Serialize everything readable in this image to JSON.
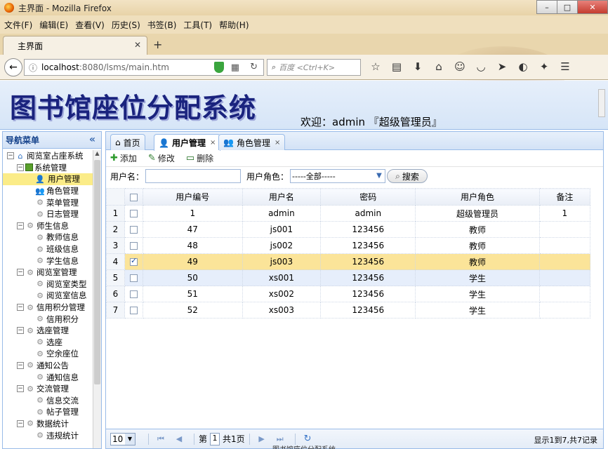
{
  "browser": {
    "window_title": "主界面 - Mozilla Firefox",
    "window_buttons": [
      "–",
      "□",
      "✕"
    ],
    "menu": [
      "文件(F)",
      "编辑(E)",
      "查看(V)",
      "历史(S)",
      "书签(B)",
      "工具(T)",
      "帮助(H)"
    ],
    "tab_title": "主界面",
    "url_host": "localhost",
    "url_path": ":8080/lsms/main.htm",
    "search_placeholder": "百度 <Ctrl+K>"
  },
  "app": {
    "system_title": "图书馆座位分配系统",
    "welcome": "欢迎：admin 『超级管理员』",
    "nav_title": "导航菜单",
    "tree": [
      {
        "label": "阅览室占座系统",
        "level": 0,
        "icon": "home-icon",
        "toggle": "−"
      },
      {
        "label": "系统管理",
        "level": 1,
        "icon": "system-icon",
        "toggle": "−"
      },
      {
        "label": "用户管理",
        "level": 2,
        "icon": "user-icon",
        "selected": true
      },
      {
        "label": "角色管理",
        "level": 2,
        "icon": "role-icon"
      },
      {
        "label": "菜单管理",
        "level": 2,
        "icon": "gear-icon"
      },
      {
        "label": "日志管理",
        "level": 2,
        "icon": "gear-icon"
      },
      {
        "label": "师生信息",
        "level": 1,
        "icon": "gear-icon",
        "toggle": "−"
      },
      {
        "label": "教师信息",
        "level": 2,
        "icon": "gear-icon"
      },
      {
        "label": "班级信息",
        "level": 2,
        "icon": "gear-icon"
      },
      {
        "label": "学生信息",
        "level": 2,
        "icon": "gear-icon"
      },
      {
        "label": "阅览室管理",
        "level": 1,
        "icon": "gear-icon",
        "toggle": "−"
      },
      {
        "label": "阅览室类型",
        "level": 2,
        "icon": "gear-icon"
      },
      {
        "label": "阅览室信息",
        "level": 2,
        "icon": "gear-icon"
      },
      {
        "label": "信用积分管理",
        "level": 1,
        "icon": "gear-icon",
        "toggle": "−"
      },
      {
        "label": "信用积分",
        "level": 2,
        "icon": "gear-icon"
      },
      {
        "label": "选座管理",
        "level": 1,
        "icon": "gear-icon",
        "toggle": "−"
      },
      {
        "label": "选座",
        "level": 2,
        "icon": "gear-icon"
      },
      {
        "label": "空余座位",
        "level": 2,
        "icon": "gear-icon"
      },
      {
        "label": "通知公告",
        "level": 1,
        "icon": "gear-icon",
        "toggle": "−"
      },
      {
        "label": "通知信息",
        "level": 2,
        "icon": "gear-icon"
      },
      {
        "label": "交流管理",
        "level": 1,
        "icon": "gear-icon",
        "toggle": "−"
      },
      {
        "label": "信息交流",
        "level": 2,
        "icon": "gear-icon"
      },
      {
        "label": "帖子管理",
        "level": 2,
        "icon": "gear-icon"
      },
      {
        "label": "数据统计",
        "level": 1,
        "icon": "gear-icon",
        "toggle": "−"
      },
      {
        "label": "违规统计",
        "level": 2,
        "icon": "gear-icon"
      }
    ],
    "tabs": [
      {
        "label": "首页",
        "icon": "home-icon",
        "closable": false
      },
      {
        "label": "用户管理",
        "icon": "user-icon",
        "closable": true,
        "active": true
      },
      {
        "label": "角色管理",
        "icon": "role-icon",
        "closable": true
      }
    ],
    "toolbar": {
      "add": "添加",
      "edit": "修改",
      "delete": "删除"
    },
    "filter": {
      "username_label": "用户名：",
      "username_value": "",
      "role_label": "用户角色：",
      "role_value": "-----全部-----",
      "search": "搜索"
    },
    "grid": {
      "columns": [
        "用户编号",
        "用户名",
        "密码",
        "用户角色",
        "备注"
      ],
      "rows": [
        {
          "no": "1",
          "checked": false,
          "cells": [
            "1",
            "admin",
            "admin",
            "超级管理员",
            "1"
          ]
        },
        {
          "no": "2",
          "checked": false,
          "cells": [
            "47",
            "js001",
            "123456",
            "教师",
            ""
          ]
        },
        {
          "no": "3",
          "checked": false,
          "cells": [
            "48",
            "js002",
            "123456",
            "教师",
            ""
          ]
        },
        {
          "no": "4",
          "checked": true,
          "selected": true,
          "cells": [
            "49",
            "js003",
            "123456",
            "教师",
            ""
          ]
        },
        {
          "no": "5",
          "checked": false,
          "hover": true,
          "cells": [
            "50",
            "xs001",
            "123456",
            "学生",
            ""
          ]
        },
        {
          "no": "6",
          "checked": false,
          "cells": [
            "51",
            "xs002",
            "123456",
            "学生",
            ""
          ]
        },
        {
          "no": "7",
          "checked": false,
          "cells": [
            "52",
            "xs003",
            "123456",
            "学生",
            ""
          ]
        }
      ]
    },
    "pager": {
      "page_size": "10",
      "page_prefix": "第",
      "page_value": "1",
      "page_suffix": "共1页",
      "info": "显示1到7,共7记录"
    },
    "footer": "图书馆座位分配系统"
  },
  "colors": {
    "selected_row": "#fbe499",
    "header_bg": "#d6e5f7",
    "border": "#99bbe8",
    "title": "#1a237e"
  }
}
